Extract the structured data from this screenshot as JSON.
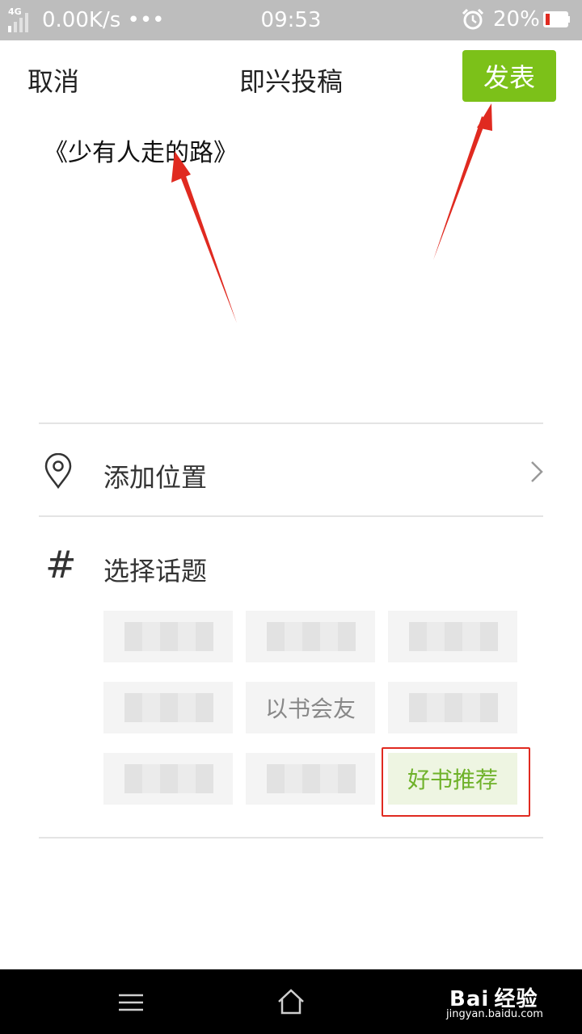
{
  "status_bar": {
    "network": "4G",
    "speed": "0.00K/s •••",
    "time": "09:53",
    "battery": "20%"
  },
  "header": {
    "cancel_label": "取消",
    "title": "即兴投稿",
    "publish_label": "发表"
  },
  "post": {
    "text": "《少有人走的路》"
  },
  "location": {
    "label": "添加位置"
  },
  "topics": {
    "label": "选择话题",
    "tags": [
      "以书会友",
      "好书推荐"
    ],
    "selected": "好书推荐"
  },
  "watermark": {
    "main": "Bai 经验",
    "sub": "jingyan.baidu.com"
  },
  "colors": {
    "accent": "#7cc119",
    "selected_tag_bg": "#eef5e2",
    "selected_tag_text": "#6fb22a",
    "annotation": "#e02a20"
  },
  "icons": {
    "location": "map-pin-icon",
    "topic": "hash-icon",
    "chevron": "chevron-right-icon",
    "alarm": "alarm-clock-icon",
    "menu": "menu-icon",
    "home": "home-icon"
  }
}
